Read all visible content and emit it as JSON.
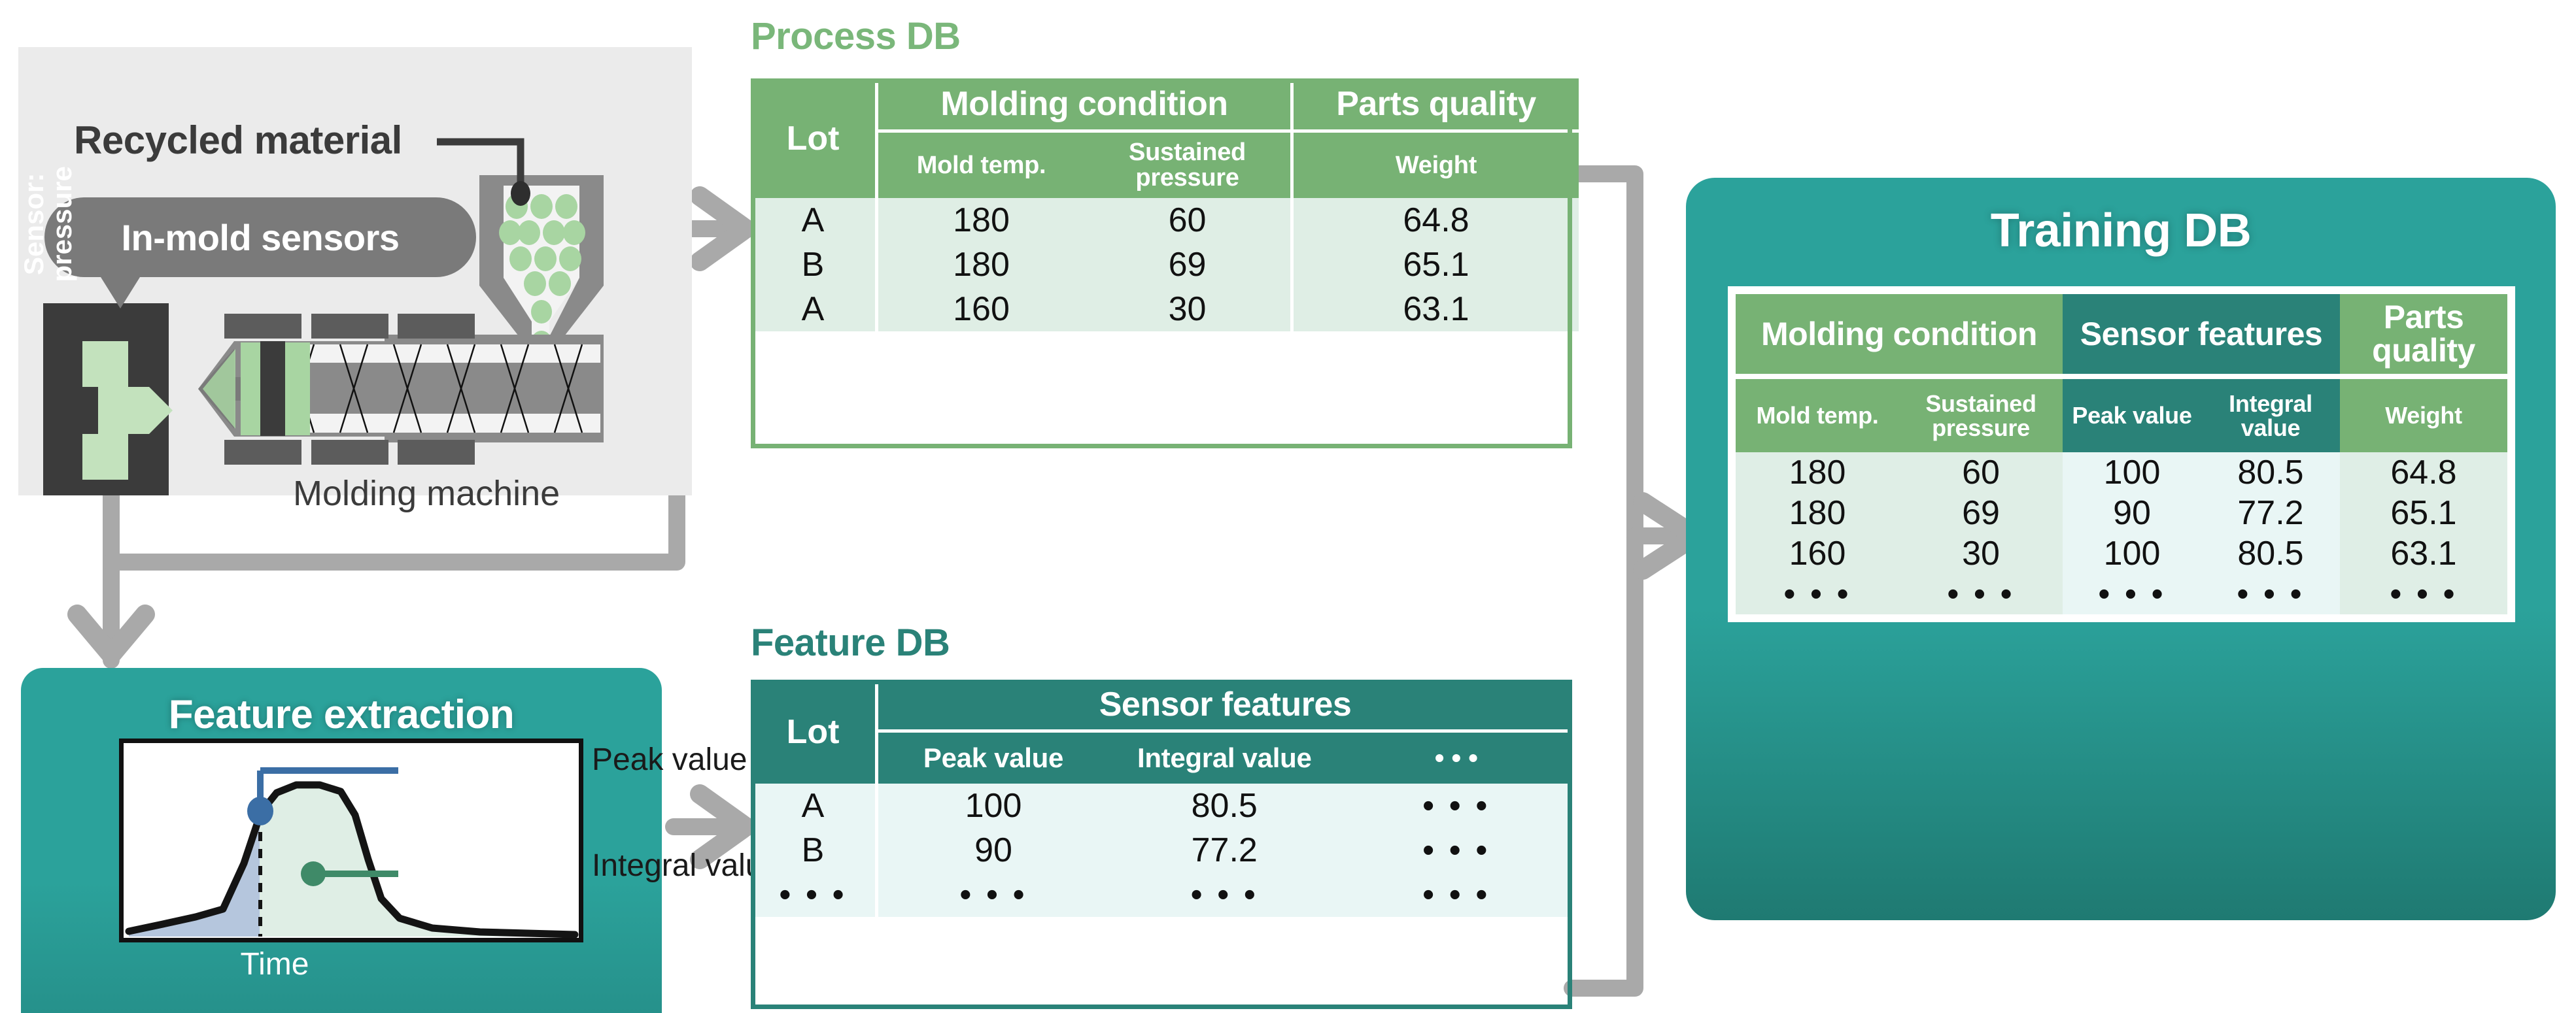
{
  "machine": {
    "recycled_label": "Recycled material",
    "sensors_callout": "In-mold  sensors",
    "machine_label": "Molding machine",
    "pellet_color": "#a8d5a2",
    "mold_color": "#3b3b3b",
    "panel_bg": "#ebebeb"
  },
  "feature_extraction": {
    "title": "Feature extraction",
    "y_axis_label": "Sensor: pressure",
    "x_axis_label": "Time",
    "peak_label": "Peak value",
    "integral_label": "Integral value",
    "peak_marker_color": "#3b6ea5",
    "integral_marker_color": "#3f8a68",
    "peak_area_color": "#b5c6dd",
    "integral_area_color": "#dfeee5",
    "panel_color": "#2ba29b"
  },
  "process_db": {
    "title": "Process DB",
    "accent": "#77b274",
    "body_bg": "#dfeee5",
    "group_headers": [
      "Lot",
      "Molding condition",
      "Parts quality"
    ],
    "columns": [
      "Lot",
      "Mold temp.",
      "Sustained pressure",
      "Weight"
    ],
    "rows": [
      {
        "lot": "A",
        "mold_temp": "180",
        "sustained_pressure": "60",
        "weight": "64.8"
      },
      {
        "lot": "B",
        "mold_temp": "180",
        "sustained_pressure": "69",
        "weight": "65.1"
      },
      {
        "lot": "A",
        "mold_temp": "160",
        "sustained_pressure": "30",
        "weight": "63.1"
      }
    ]
  },
  "feature_db": {
    "title": "Feature DB",
    "accent": "#2a8278",
    "body_bg": "#e9f6f5",
    "group_headers": [
      "Lot",
      "Sensor features"
    ],
    "columns": [
      "Lot",
      "Peak value",
      "Integral value",
      "• • •"
    ],
    "rows": [
      {
        "lot": "A",
        "peak_value": "100",
        "integral_value": "80.5",
        "more": "• • •"
      },
      {
        "lot": "B",
        "peak_value": "90",
        "integral_value": "77.2",
        "more": "• • •"
      },
      {
        "lot": "• • •",
        "peak_value": "• • •",
        "integral_value": "• • •",
        "more": "• • •"
      }
    ]
  },
  "training_db": {
    "title": "Training DB",
    "panel_color": "#2ba29b",
    "green": "#77b274",
    "teal": "#2a8278",
    "group_headers": [
      "Molding condition",
      "Sensor features",
      "Parts quality"
    ],
    "columns": [
      "Mold temp.",
      "Sustained pressure",
      "Peak value",
      "Integral value",
      "Weight"
    ],
    "rows": [
      {
        "mold_temp": "180",
        "sustained_pressure": "60",
        "peak_value": "100",
        "integral_value": "80.5",
        "weight": "64.8"
      },
      {
        "mold_temp": "180",
        "sustained_pressure": "69",
        "peak_value": "90",
        "integral_value": "77.2",
        "weight": "65.1"
      },
      {
        "mold_temp": "160",
        "sustained_pressure": "30",
        "peak_value": "100",
        "integral_value": "80.5",
        "weight": "63.1"
      },
      {
        "mold_temp": "• • •",
        "sustained_pressure": "• • •",
        "peak_value": "• • •",
        "integral_value": "• • •",
        "weight": "• • •"
      }
    ]
  },
  "connectors": {
    "color": "#a9a9a9"
  }
}
